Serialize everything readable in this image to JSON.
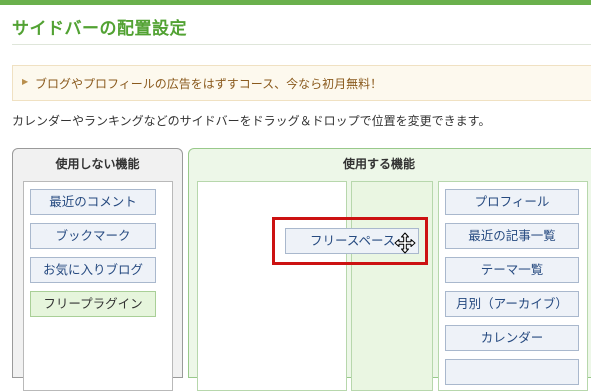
{
  "page": {
    "title": "サイドバーの配置設定",
    "notice": "ブログやプロフィールの広告をはずすコース、今なら初月無料！",
    "description": "カレンダーやランキングなどのサイドバーをドラッグ＆ドロップで位置を変更できます。"
  },
  "unused_panel": {
    "header": "使用しない機能",
    "items": [
      "最近のコメント",
      "ブックマーク",
      "お気に入りブログ",
      "フリープラグイン"
    ]
  },
  "used_panel": {
    "header": "使用する機能",
    "right_column_items": [
      "プロフィール",
      "最近の記事一覧",
      "テーマ一覧",
      "月別（アーカイブ）",
      "カレンダー"
    ]
  },
  "dragging_item": {
    "label": "フリースペース"
  },
  "icons": {
    "notice_marker": "triangle-right-icon",
    "cursor": "move-cursor-icon"
  },
  "colors": {
    "title": "#52a233",
    "highlight_border": "#cc1111",
    "item_text": "#264a80"
  }
}
